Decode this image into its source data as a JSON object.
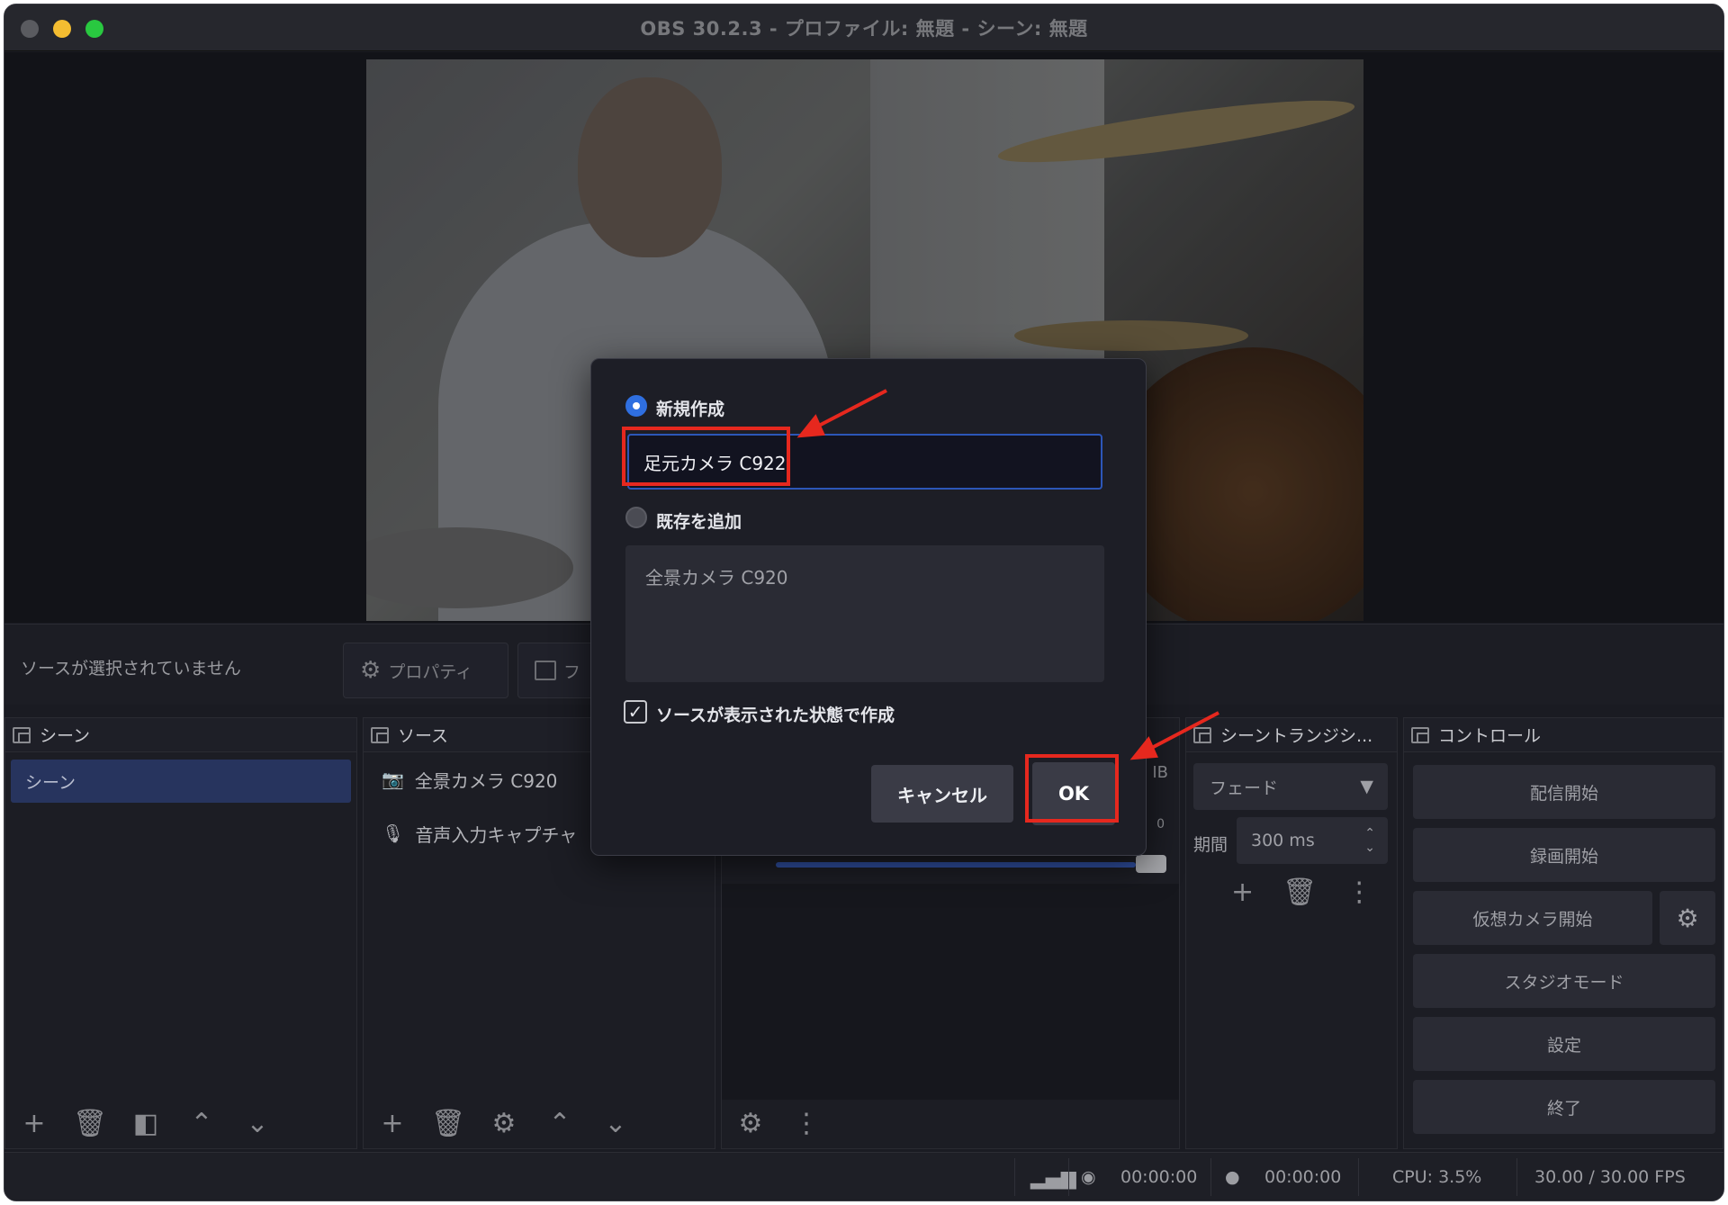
{
  "window": {
    "title": "OBS 30.2.3 - プロファイル: 無題 - シーン: 無題"
  },
  "context_bar": {
    "no_source": "ソースが選択されていません",
    "properties": "プロパティ",
    "filters": "フ"
  },
  "scenes": {
    "header": "シーン",
    "items": [
      "シーン"
    ]
  },
  "sources": {
    "header": "ソース",
    "items": [
      "全景カメラ C920",
      "音声入力キャプチャ"
    ]
  },
  "transitions": {
    "header": "シーントランジシ...",
    "type": "フェード",
    "duration_label": "期間",
    "duration": "300 ms"
  },
  "controls": {
    "header": "コントロール",
    "start_stream": "配信開始",
    "start_record": "録画開始",
    "virtual_cam": "仮想カメラ開始",
    "studio_mode": "スタジオモード",
    "settings": "設定",
    "exit": "終了"
  },
  "mixer": {
    "db_label": "IB",
    "zero": "0"
  },
  "status": {
    "stream_time": "00:00:00",
    "record_time": "00:00:00",
    "cpu": "CPU: 3.5%",
    "fps": "30.00 / 30.00 FPS"
  },
  "dialog": {
    "create_new_label": "新規作成",
    "create_new_selected": true,
    "name_value": "足元カメラ C922",
    "add_existing_label": "既存を追加",
    "existing_items": [
      "全景カメラ C920"
    ],
    "visible_label": "ソースが表示された状態で作成",
    "visible_checked": true,
    "cancel": "キャンセル",
    "ok": "OK"
  },
  "colors": {
    "accent": "#2f6fe0",
    "highlight": "#e6281e",
    "scene_selected": "#27345e"
  }
}
